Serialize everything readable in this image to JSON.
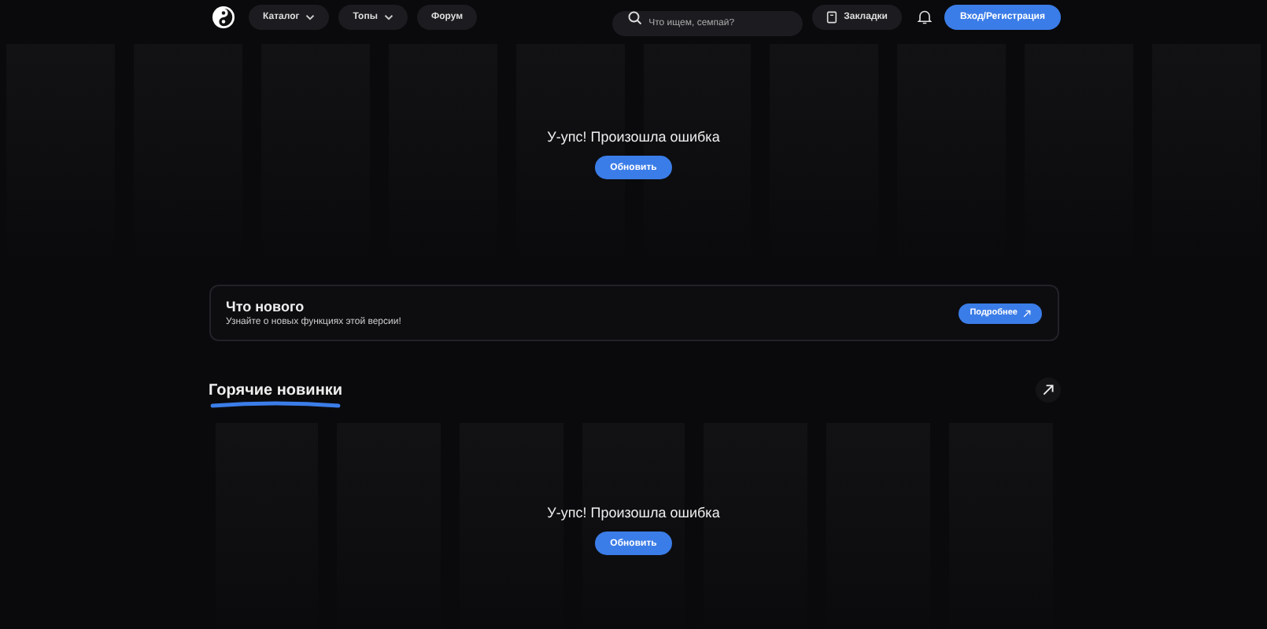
{
  "nav": [
    {
      "label": "Каталог",
      "has_menu": true
    },
    {
      "label": "Топы",
      "has_menu": true
    },
    {
      "label": "Форум",
      "has_menu": false
    }
  ],
  "search": {
    "placeholder": "Что ищем, семпай?"
  },
  "bookmarks": {
    "label": "Закладки"
  },
  "login": {
    "label": "Вход/Регистрация"
  },
  "top_section": {
    "error": "У-упс! Произошла ошибка",
    "button": "Обновить"
  },
  "whats_new": {
    "title": "Что нового",
    "text": "Узнайте о новых функциях этой версии!",
    "button": "Подробнее"
  },
  "hot_section": {
    "title": "Горячие новинки",
    "error": "У-упс! Произошла ошибка",
    "button": "Обновить"
  }
}
